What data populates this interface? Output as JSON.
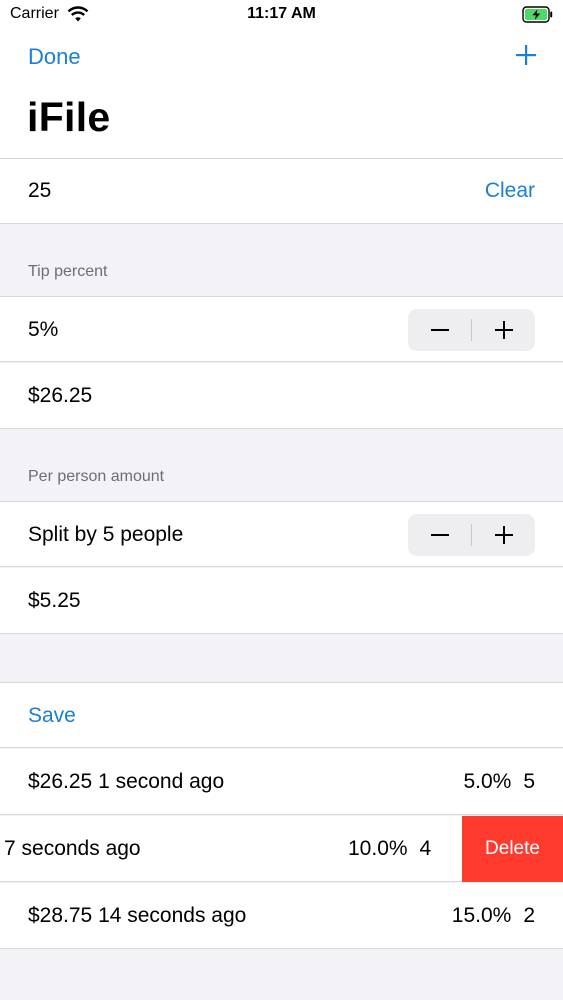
{
  "status_bar": {
    "carrier": "Carrier",
    "time": "11:17 AM",
    "battery_color": "#4cd964"
  },
  "nav": {
    "done_label": "Done",
    "add_icon": "plus-icon",
    "title": "iFile"
  },
  "amount": {
    "value": "25",
    "clear_label": "Clear"
  },
  "tip_section": {
    "header": "Tip percent",
    "percent": "5%",
    "total": "$26.25"
  },
  "person_section": {
    "header": "Per person amount",
    "split_label": "Split by 5 people",
    "per_person": "$5.25"
  },
  "history": {
    "save_label": "Save",
    "rows": [
      {
        "left": "$26.25 1 second ago",
        "percent": "5.0%",
        "people": "5"
      },
      {
        "left": "7 seconds ago",
        "percent": "10.0%",
        "people": "4",
        "action": "Delete"
      },
      {
        "left": "$28.75 14 seconds ago",
        "percent": "15.0%",
        "people": "2"
      }
    ]
  },
  "colors": {
    "accent": "#1a7fd6",
    "delete": "#ff3b30",
    "background": "#f2f2f7"
  }
}
